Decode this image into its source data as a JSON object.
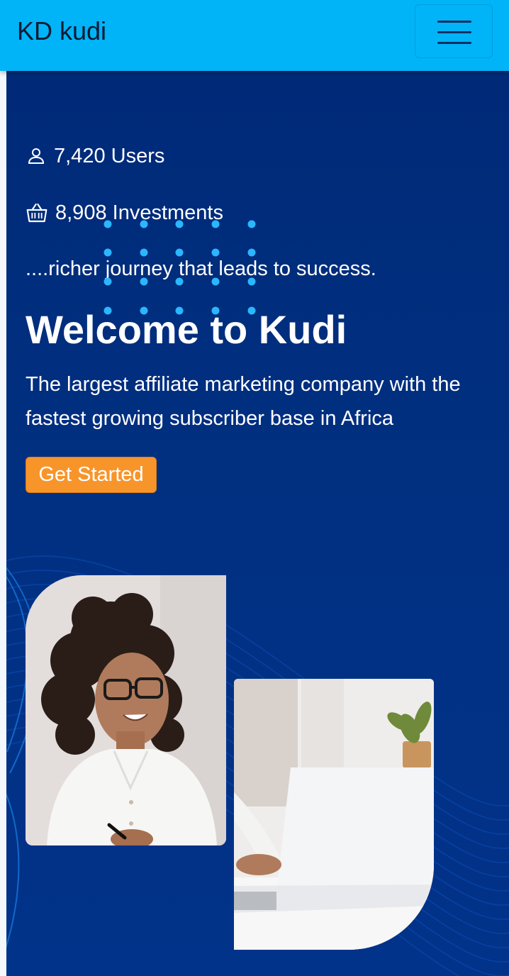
{
  "navbar": {
    "brand": "KD kudi",
    "menu_icon": "hamburger-menu-icon"
  },
  "hero": {
    "stats": [
      {
        "icon": "user-icon",
        "value": "7,420",
        "label": "Users"
      },
      {
        "icon": "basket-icon",
        "value": "8,908",
        "label": "Investments"
      }
    ],
    "tagline": "....richer journey that leads to success.",
    "title": "Welcome to Kudi",
    "subtitle_lines": [
      "The largest affiliate marketing company with the",
      "fastest growing subscriber base in Africa"
    ],
    "cta_label": "Get Started"
  },
  "colors": {
    "navbar_bg": "#00b4f7",
    "hero_bg": "#002a78",
    "accent_orange": "#f7952b",
    "dot_blue": "#2bb6ff"
  }
}
